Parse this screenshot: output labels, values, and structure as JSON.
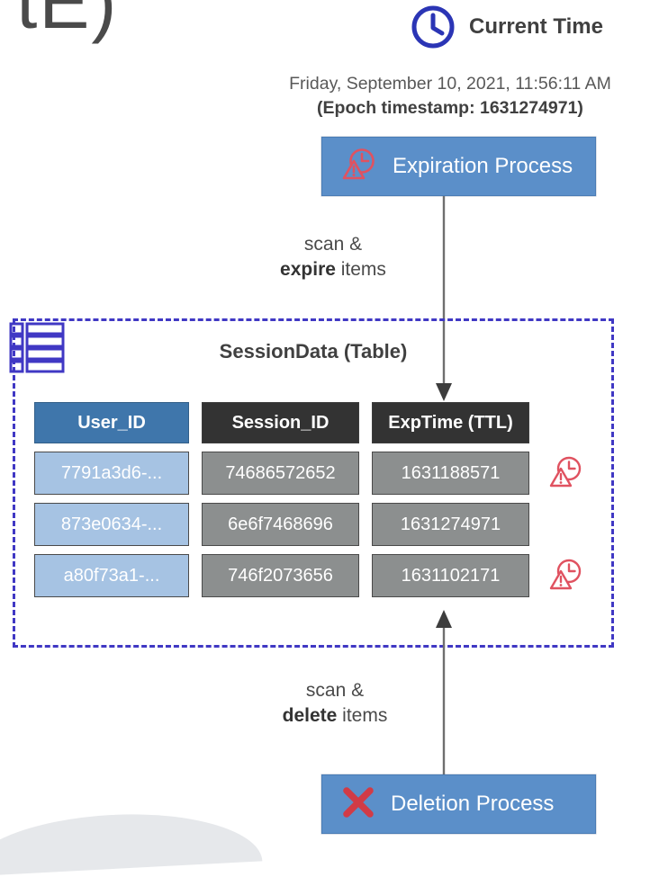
{
  "decoration": {
    "top_fragment": "tE)"
  },
  "current_time": {
    "icon": "clock-icon",
    "title": "Current Time",
    "date_line": "Friday, September 10, 2021, 11:56:11 AM",
    "epoch_line": "(Epoch timestamp: 1631274971)"
  },
  "expiration_process": {
    "label": "Expiration Process",
    "icon": "expired-clock-warning-icon",
    "box_color": "#5b8fc9",
    "icon_color": "#e05260"
  },
  "deletion_process": {
    "label": "Deletion Process",
    "icon": "red-x-icon",
    "box_color": "#5b8fc9",
    "icon_color": "#d13b46"
  },
  "arrows": {
    "expire": {
      "line1": "scan &",
      "bold": "expire",
      "line2_suffix": " items",
      "direction": "down"
    },
    "delete": {
      "line1": "scan &",
      "bold": "delete",
      "line2_suffix": " items",
      "direction": "up"
    }
  },
  "table": {
    "title": "SessionData (Table)",
    "icon": "table-icon",
    "border_color": "#4038c4",
    "columns": [
      "User_ID",
      "Session_ID",
      "ExpTime (TTL)"
    ],
    "rows": [
      {
        "user_id": "7791a3d6-...",
        "session_id": "74686572652",
        "exp_time": "1631188571",
        "expired": true
      },
      {
        "user_id": "873e0634-...",
        "session_id": "6e6f7468696",
        "exp_time": "1631274971",
        "expired": false
      },
      {
        "user_id": "a80f73a1-...",
        "session_id": "746f2073656",
        "exp_time": "1631102171",
        "expired": true
      }
    ]
  }
}
